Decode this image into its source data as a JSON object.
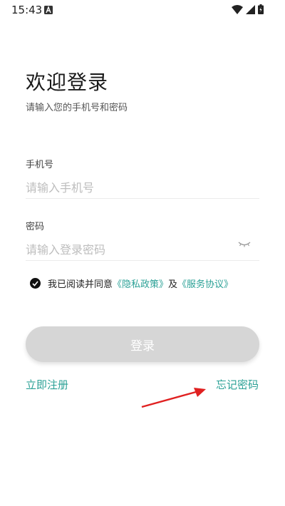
{
  "status_bar": {
    "time": "15:43",
    "icons": [
      "notification-a-icon",
      "wifi-icon",
      "signal-icon",
      "battery-icon"
    ]
  },
  "header": {
    "title": "欢迎登录",
    "subtitle": "请输入您的手机号和密码"
  },
  "phone": {
    "label": "手机号",
    "placeholder": "请输入手机号",
    "value": ""
  },
  "password": {
    "label": "密码",
    "placeholder": "请输入登录密码",
    "value": ""
  },
  "agreement": {
    "prefix": "我已阅读并同意",
    "privacy": "《隐私政策》",
    "and": "及",
    "service": "《服务协议》",
    "checked": true
  },
  "login_button": {
    "label": "登录"
  },
  "links": {
    "register": "立即注册",
    "forgot": "忘记密码"
  },
  "colors": {
    "accent": "#2ba196",
    "button_disabled": "#d6d6d6",
    "annotation_arrow": "#e02020"
  }
}
